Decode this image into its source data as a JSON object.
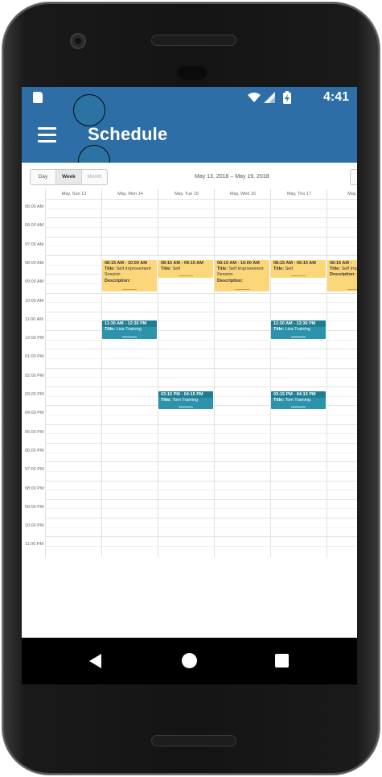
{
  "status": {
    "time": "4:41"
  },
  "appbar": {
    "title": "Schedule"
  },
  "toolbar": {
    "views": [
      "Day",
      "Week",
      "Month"
    ],
    "active_view": "Week",
    "date_range": "May 13, 2018 – May 19, 2018"
  },
  "columns": [
    "May, Sun 13",
    "May, Mon 14",
    "May, Tue 15",
    "May, Wed 16",
    "May, Thu 17",
    "May, Fri"
  ],
  "times": [
    "05:00 AM",
    "06:00 AM",
    "07:00 AM",
    "08:00 AM",
    "09:00 AM",
    "10:00 AM",
    "11:00 AM",
    "12:00 PM",
    "01:00 PM",
    "02:00 PM",
    "03:00 PM",
    "04:00 PM",
    "05:00 PM",
    "06:00 PM",
    "07:00 PM",
    "08:00 PM",
    "09:00 PM",
    "10:00 PM",
    "11:00 PM"
  ],
  "events": [
    {
      "col": 1,
      "start": 8.25,
      "end": 10.0,
      "color": "#fbd77a",
      "time": "08:15 AM - 10:00 AM",
      "title_label": "Title:",
      "title": "Self Improvement Session",
      "desc_label": "Description:"
    },
    {
      "col": 2,
      "start": 8.25,
      "end": 9.25,
      "color": "#fbd77a",
      "time": "08:15 AM - 09:15 AM",
      "title_label": "Title:",
      "title": "Self",
      "desc_label": ""
    },
    {
      "col": 3,
      "start": 8.25,
      "end": 10.0,
      "color": "#fbd77a",
      "time": "08:15 AM - 10:00 AM",
      "title_label": "Title:",
      "title": "Self Improvement Session",
      "desc_label": "Description:"
    },
    {
      "col": 4,
      "start": 8.25,
      "end": 9.25,
      "color": "#fbd77a",
      "time": "08:15 AM - 09:15 AM",
      "title_label": "Title:",
      "title": "Self",
      "desc_label": ""
    },
    {
      "col": 5,
      "start": 8.25,
      "end": 10.0,
      "color": "#fbd77a",
      "time": "08:15 AM -",
      "title_label": "Title:",
      "title": "Self Improvement",
      "desc_label": "Description:"
    },
    {
      "col": 1,
      "start": 11.5,
      "end": 12.5,
      "color": "#2c93ab",
      "time": "11:30 AM - 12:30 PM",
      "title_label": "Title:",
      "title": "Lisa Training",
      "desc_label": ""
    },
    {
      "col": 4,
      "start": 11.5,
      "end": 12.5,
      "color": "#2c93ab",
      "time": "11:30 AM - 12:30 PM",
      "title_label": "Title:",
      "title": "Lisa Training",
      "desc_label": ""
    },
    {
      "col": 2,
      "start": 15.25,
      "end": 16.25,
      "color": "#2c93ab",
      "time": "03:15 PM - 04:15 PM",
      "title_label": "Title:",
      "title": "Tom Training",
      "desc_label": ""
    },
    {
      "col": 4,
      "start": 15.25,
      "end": 16.25,
      "color": "#2c93ab",
      "time": "03:15 PM - 04:15 PM",
      "title_label": "Title:",
      "title": "Tom Training",
      "desc_label": ""
    }
  ],
  "colors": {
    "accent": "#2d6ea6",
    "event_yellow": "#fbd77a",
    "event_teal": "#2c93ab"
  },
  "icons": {
    "status": [
      "sd-card-icon",
      "wifi-icon",
      "signal-icon",
      "battery-charging-icon"
    ],
    "nav": [
      "back-icon",
      "home-icon",
      "recents-icon"
    ]
  }
}
